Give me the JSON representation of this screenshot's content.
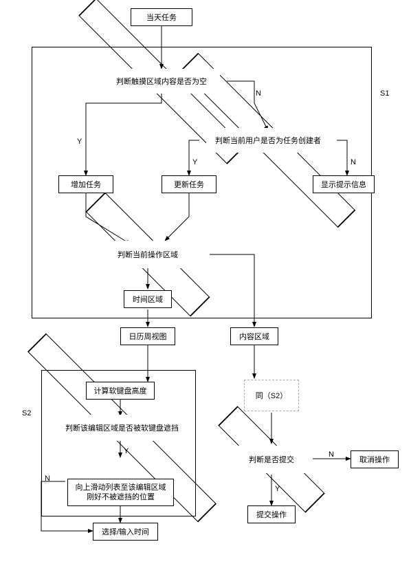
{
  "chart_data": {
    "type": "flowchart",
    "regions": [
      {
        "id": "S1",
        "label": "S1"
      },
      {
        "id": "S2",
        "label": "S2"
      }
    ],
    "nodes": [
      {
        "id": "n1",
        "type": "process",
        "label": "当天任务"
      },
      {
        "id": "n2",
        "type": "decision",
        "label": "判断触摸区域内容是否为空"
      },
      {
        "id": "n3",
        "type": "decision",
        "label": "判断当前用户是否为任务创建者"
      },
      {
        "id": "n4",
        "type": "process",
        "label": "增加任务"
      },
      {
        "id": "n5",
        "type": "process",
        "label": "更新任务"
      },
      {
        "id": "n6",
        "type": "process",
        "label": "显示提示信息"
      },
      {
        "id": "n7",
        "type": "decision",
        "label": "判断当前操作区域"
      },
      {
        "id": "n8",
        "type": "process",
        "label": "时间区域"
      },
      {
        "id": "n9",
        "type": "process",
        "label": "日历周视图"
      },
      {
        "id": "n10",
        "type": "process",
        "label": "内容区域"
      },
      {
        "id": "n11",
        "type": "process",
        "label": "计算软键盘高度"
      },
      {
        "id": "n12",
        "type": "decision",
        "label": "判断该编辑区域是否被软键盘遮挡"
      },
      {
        "id": "n13",
        "type": "process",
        "label": "向上滑动列表至该编辑区域刚好不被遮挡的位置"
      },
      {
        "id": "n14",
        "type": "process",
        "label": "选择/输入时间"
      },
      {
        "id": "n15",
        "type": "subroutine",
        "label": "同（S2）"
      },
      {
        "id": "n16",
        "type": "decision",
        "label": "判断是否提交"
      },
      {
        "id": "n17",
        "type": "process",
        "label": "取消操作"
      },
      {
        "id": "n18",
        "type": "process",
        "label": "提交操作"
      }
    ],
    "edges": [
      {
        "from": "n1",
        "to": "n2"
      },
      {
        "from": "n2",
        "to": "n4",
        "label": "Y"
      },
      {
        "from": "n2",
        "to": "n3",
        "label": "N"
      },
      {
        "from": "n3",
        "to": "n5",
        "label": "Y"
      },
      {
        "from": "n3",
        "to": "n6",
        "label": "N"
      },
      {
        "from": "n4",
        "to": "n7"
      },
      {
        "from": "n5",
        "to": "n7"
      },
      {
        "from": "n7",
        "to": "n8"
      },
      {
        "from": "n7",
        "to": "n10"
      },
      {
        "from": "n8",
        "to": "n9"
      },
      {
        "from": "n9",
        "to": "n11"
      },
      {
        "from": "n11",
        "to": "n12"
      },
      {
        "from": "n12",
        "to": "n13",
        "label": "Y"
      },
      {
        "from": "n12",
        "to": "n14",
        "label": "N"
      },
      {
        "from": "n13",
        "to": "n14"
      },
      {
        "from": "n10",
        "to": "n15"
      },
      {
        "from": "n15",
        "to": "n16"
      },
      {
        "from": "n16",
        "to": "n18",
        "label": "Y"
      },
      {
        "from": "n16",
        "to": "n17",
        "label": "N"
      }
    ]
  },
  "labels": {
    "s1": "S1",
    "s2": "S2",
    "y": "Y",
    "n": "N"
  }
}
